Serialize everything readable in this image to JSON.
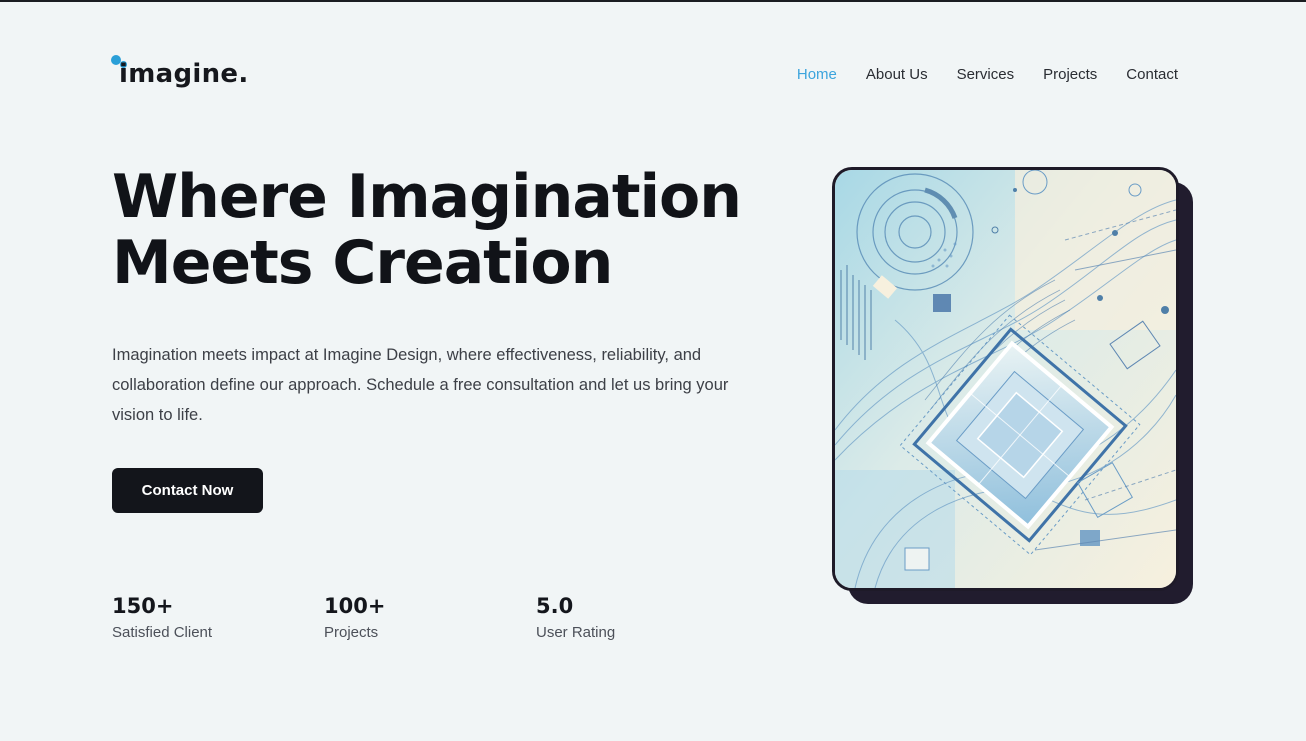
{
  "brand": {
    "logo_text": "imagine.",
    "accent_color": "#3ca4dd"
  },
  "nav": {
    "items": [
      {
        "label": "Home",
        "active": true
      },
      {
        "label": "About Us",
        "active": false
      },
      {
        "label": "Services",
        "active": false
      },
      {
        "label": "Projects",
        "active": false
      },
      {
        "label": "Contact",
        "active": false
      }
    ]
  },
  "hero": {
    "title_line1": "Where Imagination",
    "title_line2": "Meets Creation",
    "description": "Imagination meets impact at Imagine Design, where effectiveness, reliability, and collaboration define our approach. Schedule a free consultation and let us bring your vision to life.",
    "cta_label": "Contact Now"
  },
  "stats": [
    {
      "value": "150+",
      "label": "Satisfied Client"
    },
    {
      "value": "100+",
      "label": "Projects"
    },
    {
      "value": "5.0",
      "label": "User Rating"
    }
  ],
  "illustration": {
    "icon": "abstract-tech-illustration",
    "palette": [
      "#a9d6e5",
      "#f5efdf",
      "#6a9cc6",
      "#3f73a8"
    ]
  }
}
